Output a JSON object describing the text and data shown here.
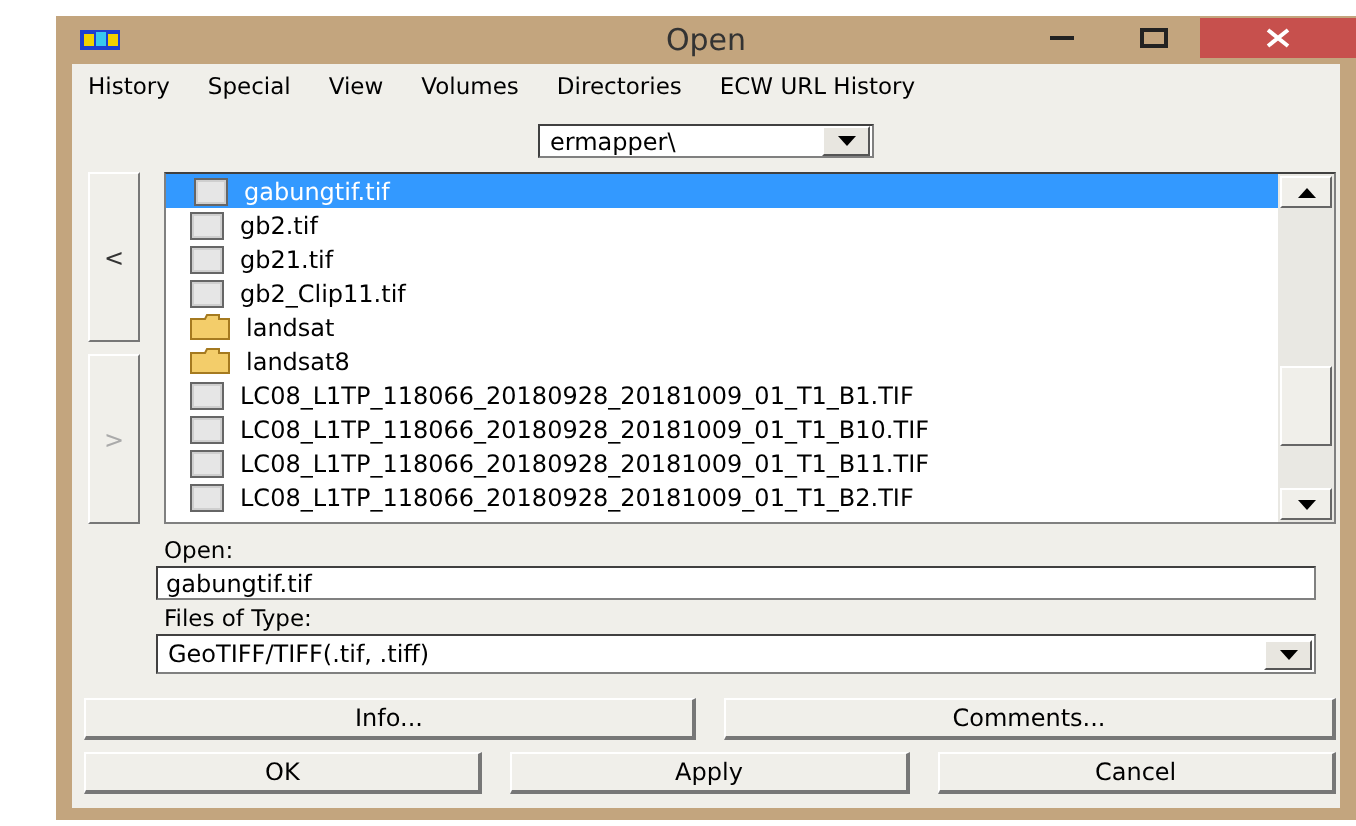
{
  "window": {
    "title": "Open"
  },
  "menu": [
    "History",
    "Special",
    "View",
    "Volumes",
    "Directories",
    "ECW URL History"
  ],
  "directory": {
    "value": "ermapper\\"
  },
  "nav": [
    "<",
    ">"
  ],
  "files": [
    {
      "name": "gabungtif.tif",
      "kind": "file",
      "selected": true
    },
    {
      "name": "gb2.tif",
      "kind": "file",
      "selected": false
    },
    {
      "name": "gb21.tif",
      "kind": "file",
      "selected": false
    },
    {
      "name": "gb2_Clip11.tif",
      "kind": "file",
      "selected": false
    },
    {
      "name": "landsat",
      "kind": "folder",
      "selected": false
    },
    {
      "name": "landsat8",
      "kind": "folder",
      "selected": false
    },
    {
      "name": "LC08_L1TP_118066_20180928_20181009_01_T1_B1.TIF",
      "kind": "file",
      "selected": false
    },
    {
      "name": "LC08_L1TP_118066_20180928_20181009_01_T1_B10.TIF",
      "kind": "file",
      "selected": false
    },
    {
      "name": "LC08_L1TP_118066_20180928_20181009_01_T1_B11.TIF",
      "kind": "file",
      "selected": false
    },
    {
      "name": "LC08_L1TP_118066_20180928_20181009_01_T1_B2.TIF",
      "kind": "file",
      "selected": false
    }
  ],
  "open": {
    "label": "Open:",
    "value": "gabungtif.tif"
  },
  "file_type": {
    "label": "Files of Type:",
    "value": "GeoTIFF/TIFF(.tif, .tiff)"
  },
  "buttons_top": [
    "Info...",
    "Comments..."
  ],
  "buttons_bottom": [
    "OK",
    "Apply",
    "Cancel"
  ]
}
